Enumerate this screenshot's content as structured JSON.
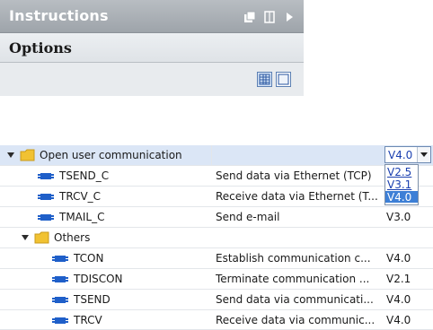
{
  "panel": {
    "title": "Instructions",
    "icons": [
      "float-window-icon",
      "pin-icon",
      "collapse-arrow-icon"
    ]
  },
  "options": {
    "title": "Options",
    "view_buttons": [
      "grid-view-icon",
      "single-view-icon"
    ]
  },
  "tree": {
    "rows": [
      {
        "name": "Open user communication",
        "description": "",
        "version": "V4.0",
        "type": "folder",
        "expanded": true,
        "selected": true
      },
      {
        "name": "TSEND_C",
        "description": "Send data via Ethernet (TCP)",
        "version": "V2.5",
        "type": "block"
      },
      {
        "name": "TRCV_C",
        "description": "Receive data via Ethernet (T...",
        "version": "V3.1",
        "type": "block"
      },
      {
        "name": "TMAIL_C",
        "description": "Send e-mail",
        "version": "V3.0",
        "type": "block"
      },
      {
        "name": "Others",
        "description": "",
        "version": "",
        "type": "folder",
        "expanded": true
      },
      {
        "name": "TCON",
        "description": "Establish communication c...",
        "version": "V4.0",
        "type": "block"
      },
      {
        "name": "TDISCON",
        "description": "Terminate communication ...",
        "version": "V2.1",
        "type": "block"
      },
      {
        "name": "TSEND",
        "description": "Send data via communicati...",
        "version": "V4.0",
        "type": "block"
      },
      {
        "name": "TRCV",
        "description": "Receive data via communic...",
        "version": "V4.0",
        "type": "block"
      }
    ]
  },
  "version_dropdown": {
    "selected": "V4.0",
    "options": [
      "V2.5",
      "V3.1",
      "V4.0"
    ]
  },
  "colors": {
    "header_bar": "#a6acb2",
    "selection": "#dbe6f6",
    "dropdown_highlight": "#3d7fd6",
    "block_icon": "#1f5fc9",
    "folder": "#f1c232"
  }
}
